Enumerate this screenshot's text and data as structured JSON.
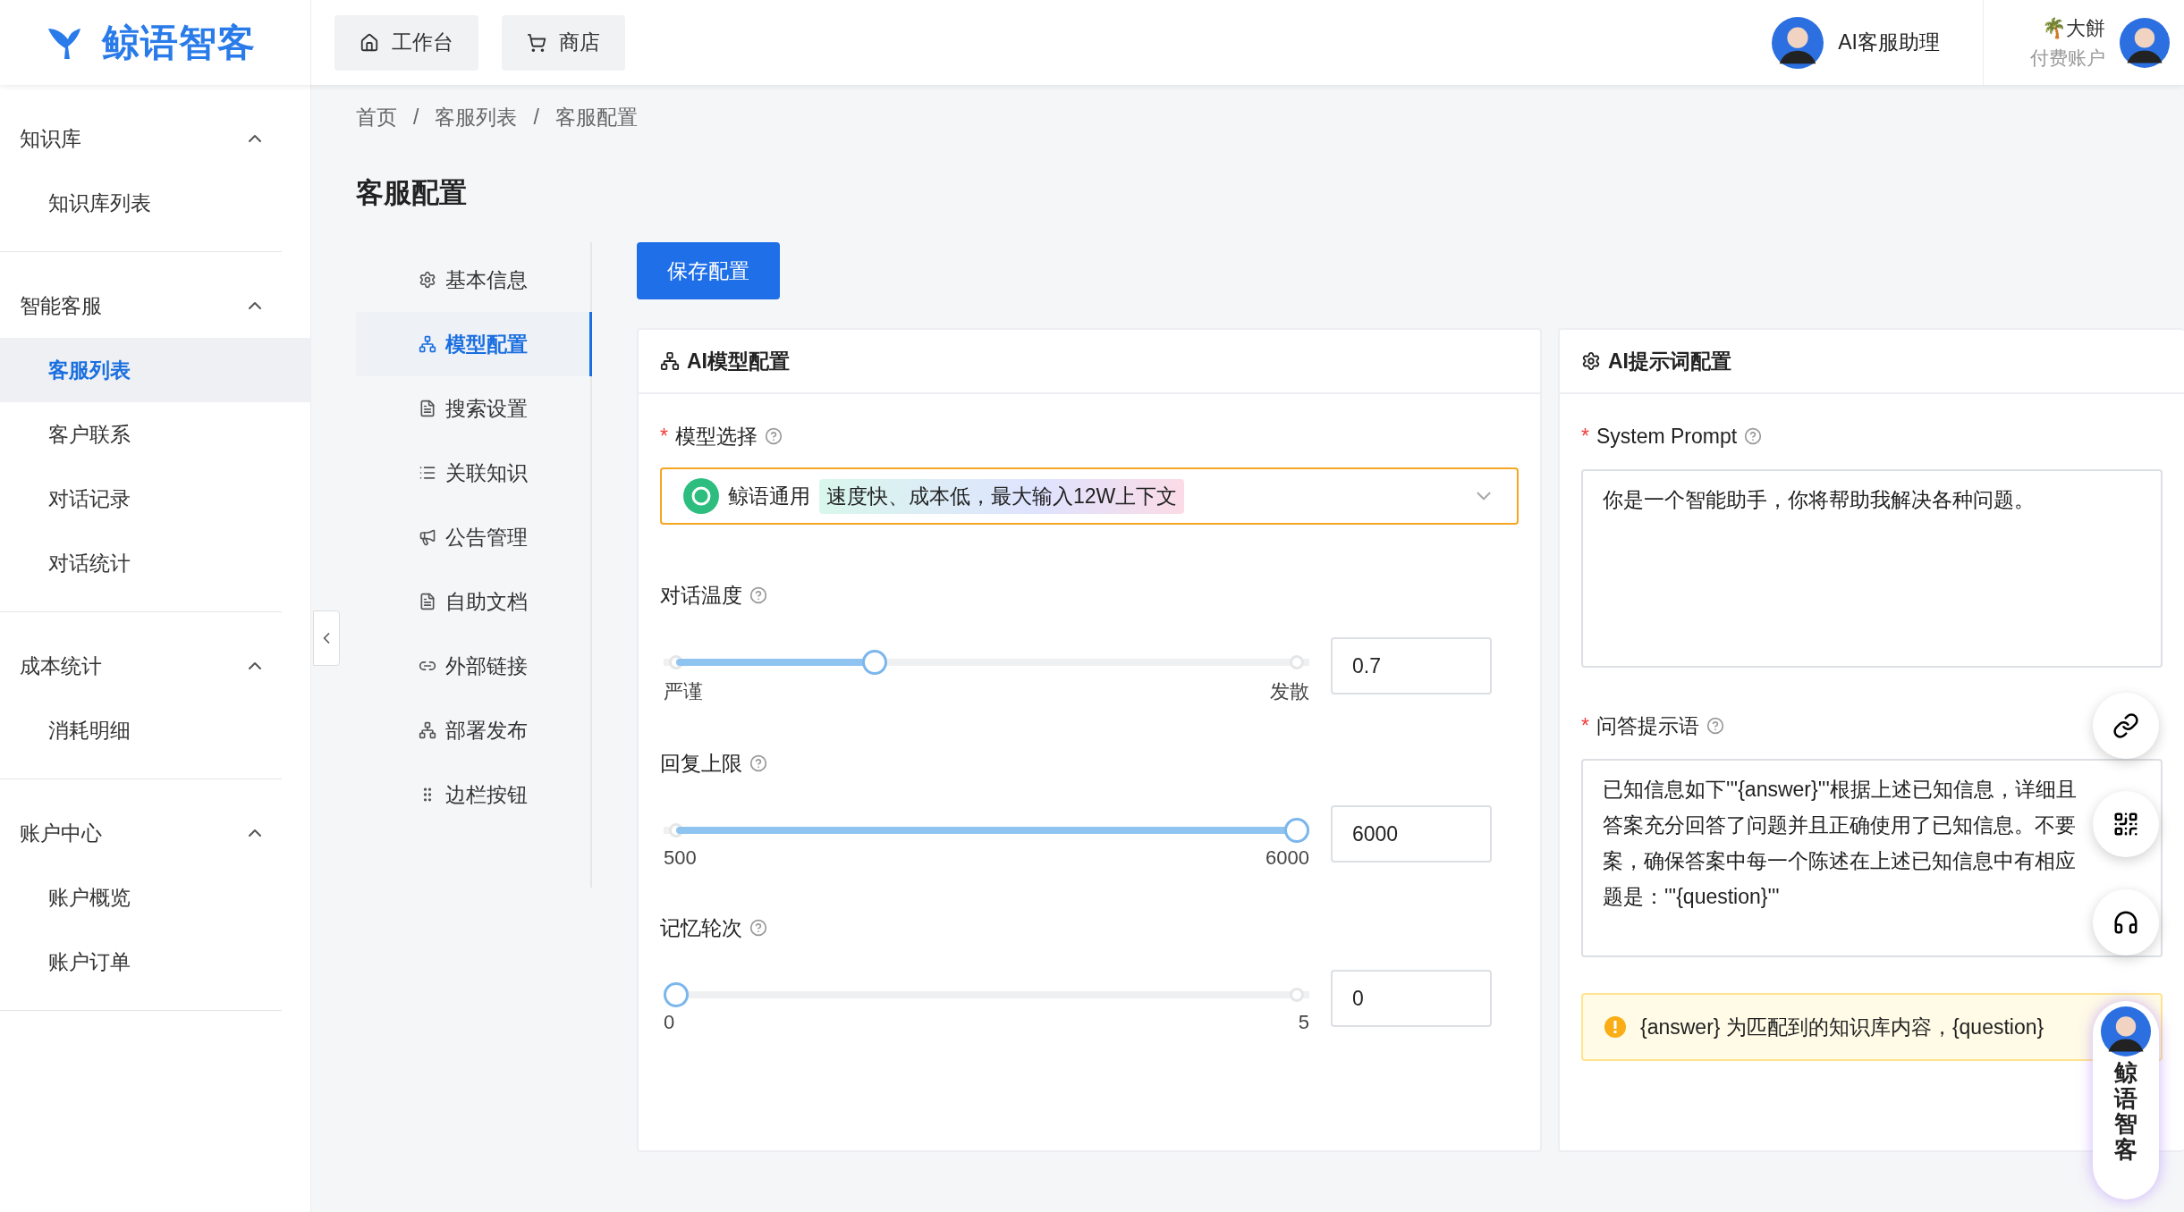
{
  "brand": {
    "name": "鲸语智客"
  },
  "top_nav": [
    {
      "label": "工作台",
      "kind": "home"
    },
    {
      "label": "商店",
      "kind": "cart"
    }
  ],
  "assistant": {
    "label": "AI客服助理"
  },
  "user": {
    "name": "🌴大餅",
    "plan": "付费账户"
  },
  "sidebar": {
    "groups": [
      {
        "title": "知识库",
        "expanded": true,
        "items": [
          {
            "label": "知识库列表",
            "selected": false
          }
        ]
      },
      {
        "title": "智能客服",
        "expanded": true,
        "items": [
          {
            "label": "客服列表",
            "selected": true
          },
          {
            "label": "客户联系",
            "selected": false
          },
          {
            "label": "对话记录",
            "selected": false
          },
          {
            "label": "对话统计",
            "selected": false
          }
        ]
      },
      {
        "title": "成本统计",
        "expanded": true,
        "items": [
          {
            "label": "消耗明细",
            "selected": false
          }
        ]
      },
      {
        "title": "账户中心",
        "expanded": true,
        "items": [
          {
            "label": "账户概览",
            "selected": false
          },
          {
            "label": "账户订单",
            "selected": false
          }
        ]
      }
    ]
  },
  "breadcrumb": [
    {
      "label": "首页"
    },
    {
      "separator": "/",
      "label": "客服列表"
    },
    {
      "separator": "/",
      "label": "客服配置"
    }
  ],
  "page_title": "客服配置",
  "config_nav": [
    {
      "label": "基本信息",
      "kind": "gear",
      "selected": false
    },
    {
      "label": "模型配置",
      "kind": "model",
      "selected": true
    },
    {
      "label": "搜索设置",
      "kind": "doc",
      "selected": false
    },
    {
      "label": "关联知识",
      "kind": "list",
      "selected": false
    },
    {
      "label": "公告管理",
      "kind": "megaphone",
      "selected": false
    },
    {
      "label": "自助文档",
      "kind": "doc",
      "selected": false
    },
    {
      "label": "外部链接",
      "kind": "link",
      "selected": false
    },
    {
      "label": "部署发布",
      "kind": "deploy",
      "selected": false
    },
    {
      "label": "边栏按钮",
      "kind": "dots",
      "selected": false
    }
  ],
  "save_button": "保存配置",
  "model_card": {
    "title": "AI模型配置",
    "model_required": "*",
    "model_label": "模型选择",
    "model_name": "鲸语通用",
    "model_tag": "速度快、成本低，最大输入12W上下文",
    "sliders": [
      {
        "label": "对话温度",
        "level": 0.32,
        "min_label": "严谨",
        "max_label": "发散",
        "value": "0.7"
      },
      {
        "label": "回复上限",
        "level": 1,
        "min_label": "500",
        "max_label": "6000",
        "value": "6000"
      },
      {
        "label": "记忆轮次",
        "level": 0,
        "min_label": "0",
        "max_label": "5",
        "value": "0"
      }
    ]
  },
  "prompt_card": {
    "title": "AI提示词配置",
    "system_required": "*",
    "system_label": "System Prompt",
    "system_value": "你是一个智能助手，你将帮助我解决各种问题。",
    "qa_required": "*",
    "qa_label": "问答提示语",
    "qa_lines": [
      "已知信息如下'''{answer}'''根据上述已知信息，详细且",
      "答案充分回答了问题并且正确使用了已知信息。不要",
      "案，确保答案中每一个陈述在上述已知信息中有相应",
      "题是：'''{question}'''"
    ],
    "notice": "{answer} 为匹配到的知识库内容，{question}"
  },
  "float_widget": {
    "label": "鲸语智客"
  }
}
